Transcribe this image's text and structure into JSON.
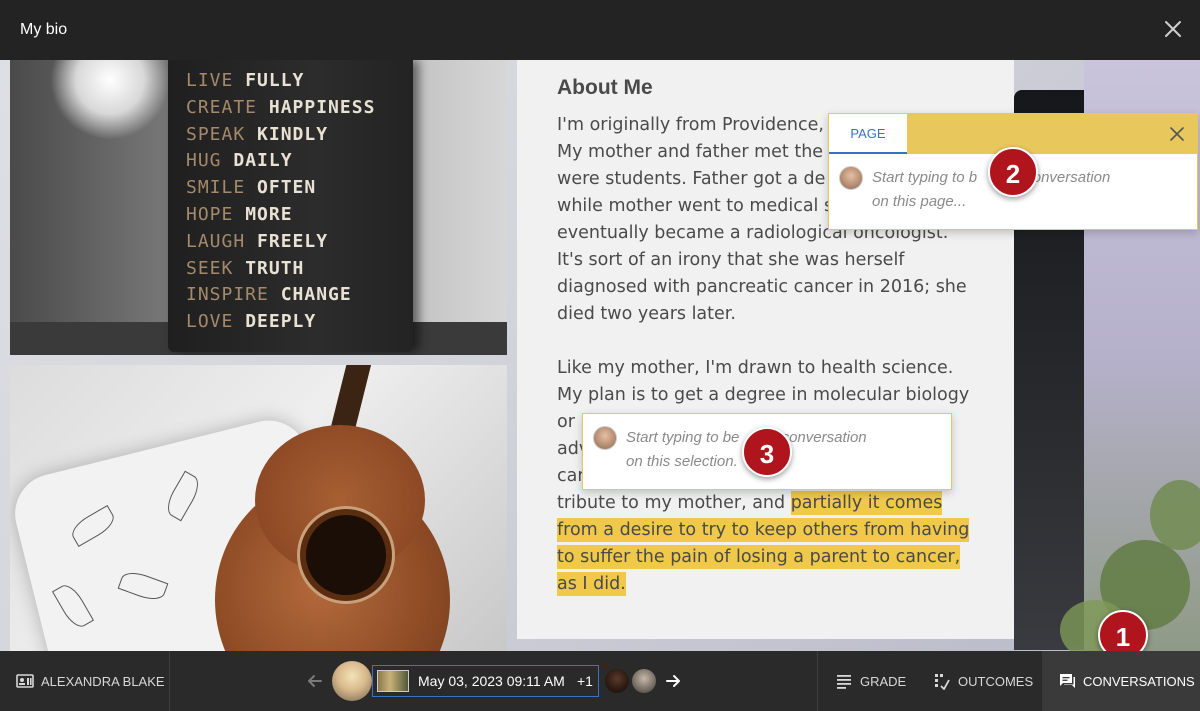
{
  "window": {
    "title": "My bio"
  },
  "photo_book": {
    "lines": [
      [
        "LIVE",
        "FULLY"
      ],
      [
        "CREATE",
        "HAPPINESS"
      ],
      [
        "SPEAK",
        "KINDLY"
      ],
      [
        "HUG",
        "DAILY"
      ],
      [
        "SMILE",
        "OFTEN"
      ],
      [
        "HOPE",
        "MORE"
      ],
      [
        "LAUGH",
        "FREELY"
      ],
      [
        "SEEK",
        "TRUTH"
      ],
      [
        "INSPIRE",
        "CHANGE"
      ],
      [
        "LOVE",
        "DEEPLY"
      ]
    ]
  },
  "bio": {
    "heading": "About Me",
    "para1": [
      "I'm originally from Providence,",
      "My mother and father met the",
      "were students. Father got a de",
      "while mother went to medical s",
      "eventually became a radiological oncologist.",
      "It's sort of an irony that she was herself",
      "diagnosed with pancreatic cancer in 2016; she",
      "died two years later."
    ],
    "para2": [
      "Like my mother, I'm drawn to health science.",
      "My plan is to get a degree in molecular biology",
      "or",
      "adv",
      "car"
    ],
    "para2_line6_plain": "tribute to my mother, and ",
    "para2_line6_highlight": "partially it comes",
    "highlight_lines": [
      "from a desire to try to keep others from having",
      "to suffer the pain of losing a parent to cancer,",
      "as I did."
    ]
  },
  "page_popover": {
    "tab": "PAGE",
    "placeholder_line1": "Start typing to b",
    "placeholder_line1_end": "conversation",
    "placeholder_line2": "on this page..."
  },
  "selection_popover": {
    "placeholder_line1": "Start typing to be",
    "placeholder_line1_end": "conversation",
    "placeholder_line2": "on this selection."
  },
  "badges": [
    "1",
    "2",
    "3"
  ],
  "bottom_bar": {
    "student_name": "ALEXANDRA BLAKE",
    "submission_date": "May 03, 2023 09:11 AM",
    "extra_count": "+1",
    "grade_label": "GRADE",
    "outcomes_label": "OUTCOMES",
    "conversations_label": "CONVERSATIONS"
  },
  "colors": {
    "highlight": "#f0c84a",
    "popover_header": "#e8c85c",
    "tab_active": "#3a6fc4",
    "badge": "#b0151d",
    "date_border": "#3b74c6"
  }
}
